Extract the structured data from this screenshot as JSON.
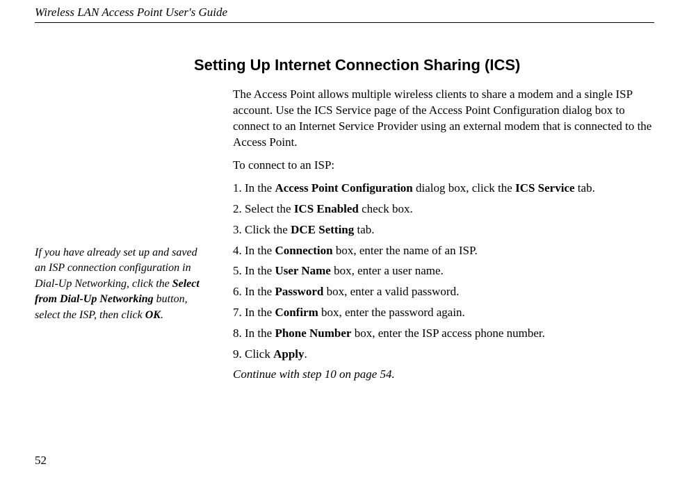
{
  "header": {
    "title": "Wireless LAN Access Point User's Guide"
  },
  "sidebar": {
    "note_part1": "If you have already set up and saved an ISP connection configuration in Dial-Up Networking, click the ",
    "note_bold1": "Select from Dial-Up Networking",
    "note_part2": " button, select the ISP, then click ",
    "note_bold2": "OK",
    "note_part3": "."
  },
  "section": {
    "title": "Setting Up Internet Connection Sharing (ICS)",
    "intro": "The Access Point allows multiple wireless clients to share a modem and a single ISP account. Use the ICS Service page of the Access Point Configuration dialog box to connect to an Internet Service Provider using an external modem that is connected to the Access Point.",
    "instruction": "To connect to an ISP:",
    "steps": [
      {
        "n": "1.",
        "pre": " In the ",
        "bold": "Access Point Configuration",
        "mid": " dialog box, click the ",
        "bold2": "ICS Service",
        "post": " tab."
      },
      {
        "n": "2.",
        "pre": " Select the ",
        "bold": "ICS Enabled",
        "post": " check box."
      },
      {
        "n": "3.",
        "pre": " Click the ",
        "bold": "DCE Setting",
        "post": " tab."
      },
      {
        "n": "4.",
        "pre": " In the ",
        "bold": "Connection",
        "post": " box, enter the name of an ISP."
      },
      {
        "n": "5.",
        "pre": " In the ",
        "bold": "User Name",
        "post": " box, enter a user name."
      },
      {
        "n": "6.",
        "pre": " In the ",
        "bold": "Password",
        "post": " box, enter a valid password."
      },
      {
        "n": "7.",
        "pre": " In the ",
        "bold": "Confirm",
        "post": " box, enter the password again."
      },
      {
        "n": "8.",
        "pre": " In the ",
        "bold": "Phone Number",
        "post": " box, enter the ISP access phone number."
      },
      {
        "n": "9.",
        "pre": " Click ",
        "bold": "Apply",
        "post": "."
      }
    ],
    "continue": "Continue with step 10 on page 54."
  },
  "page_number": "52"
}
